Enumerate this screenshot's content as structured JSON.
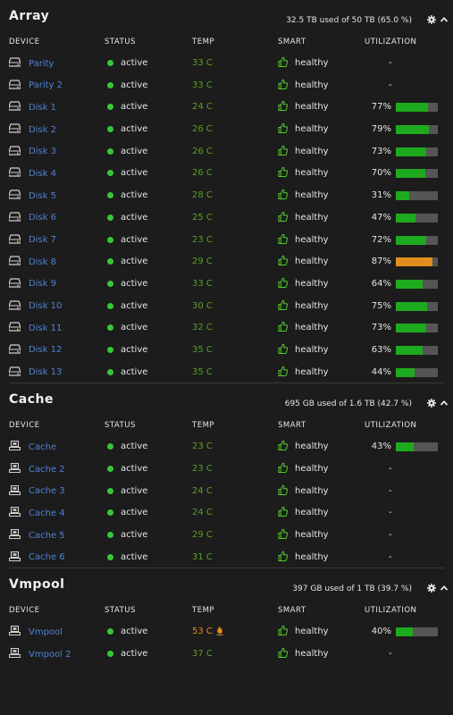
{
  "columns": {
    "device": "DEVICE",
    "status": "STATUS",
    "temp": "TEMP",
    "smart": "SMART",
    "utilization": "UTILIZATION"
  },
  "colors": {
    "accent": "#4f82d4",
    "active_dot": "#37c837",
    "temp_ok": "#5d9d2a",
    "temp_warn": "#e38c1e",
    "bar_ok": "#1eaa1e",
    "bar_warn": "#e38c1e",
    "bar_track": "#555555"
  },
  "sections": [
    {
      "title": "Array",
      "usage": "32.5 TB used of 50 TB (65.0 %)",
      "icon": "hard-drive-icon",
      "rows": [
        {
          "name": "Parity",
          "status": "active",
          "temp": "33 C",
          "smart": "healthy",
          "util": "-"
        },
        {
          "name": "Parity 2",
          "status": "active",
          "temp": "33 C",
          "smart": "healthy",
          "util": "-"
        },
        {
          "name": "Disk 1",
          "status": "active",
          "temp": "24 C",
          "smart": "healthy",
          "util": "77%",
          "pct": 0.77
        },
        {
          "name": "Disk 2",
          "status": "active",
          "temp": "26 C",
          "smart": "healthy",
          "util": "79%",
          "pct": 0.79
        },
        {
          "name": "Disk 3",
          "status": "active",
          "temp": "26 C",
          "smart": "healthy",
          "util": "73%",
          "pct": 0.73
        },
        {
          "name": "Disk 4",
          "status": "active",
          "temp": "26 C",
          "smart": "healthy",
          "util": "70%",
          "pct": 0.7
        },
        {
          "name": "Disk 5",
          "status": "active",
          "temp": "28 C",
          "smart": "healthy",
          "util": "31%",
          "pct": 0.31
        },
        {
          "name": "Disk 6",
          "status": "active",
          "temp": "25 C",
          "smart": "healthy",
          "util": "47%",
          "pct": 0.47
        },
        {
          "name": "Disk 7",
          "status": "active",
          "temp": "23 C",
          "smart": "healthy",
          "util": "72%",
          "pct": 0.72
        },
        {
          "name": "Disk 8",
          "status": "active",
          "temp": "29 C",
          "smart": "healthy",
          "util": "87%",
          "pct": 0.87,
          "warn": true
        },
        {
          "name": "Disk 9",
          "status": "active",
          "temp": "33 C",
          "smart": "healthy",
          "util": "64%",
          "pct": 0.64
        },
        {
          "name": "Disk 10",
          "status": "active",
          "temp": "30 C",
          "smart": "healthy",
          "util": "75%",
          "pct": 0.75
        },
        {
          "name": "Disk 11",
          "status": "active",
          "temp": "32 C",
          "smart": "healthy",
          "util": "73%",
          "pct": 0.73
        },
        {
          "name": "Disk 12",
          "status": "active",
          "temp": "35 C",
          "smart": "healthy",
          "util": "63%",
          "pct": 0.63
        },
        {
          "name": "Disk 13",
          "status": "active",
          "temp": "35 C",
          "smart": "healthy",
          "util": "44%",
          "pct": 0.44
        }
      ]
    },
    {
      "title": "Cache",
      "usage": "695 GB used of 1.6 TB (42.7 %)",
      "icon": "ssd-icon",
      "rows": [
        {
          "name": "Cache",
          "status": "active",
          "temp": "23 C",
          "smart": "healthy",
          "util": "43%",
          "pct": 0.43
        },
        {
          "name": "Cache 2",
          "status": "active",
          "temp": "23 C",
          "smart": "healthy",
          "util": "-"
        },
        {
          "name": "Cache 3",
          "status": "active",
          "temp": "24 C",
          "smart": "healthy",
          "util": "-"
        },
        {
          "name": "Cache 4",
          "status": "active",
          "temp": "24 C",
          "smart": "healthy",
          "util": "-"
        },
        {
          "name": "Cache 5",
          "status": "active",
          "temp": "29 C",
          "smart": "healthy",
          "util": "-"
        },
        {
          "name": "Cache 6",
          "status": "active",
          "temp": "31 C",
          "smart": "healthy",
          "util": "-"
        }
      ]
    },
    {
      "title": "Vmpool",
      "usage": "397 GB used of 1 TB (39.7 %)",
      "icon": "ssd-icon",
      "rows": [
        {
          "name": "Vmpool",
          "status": "active",
          "temp": "53 C",
          "hot": true,
          "smart": "healthy",
          "util": "40%",
          "pct": 0.4
        },
        {
          "name": "Vmpool 2",
          "status": "active",
          "temp": "37 C",
          "smart": "healthy",
          "util": "-"
        }
      ]
    }
  ]
}
